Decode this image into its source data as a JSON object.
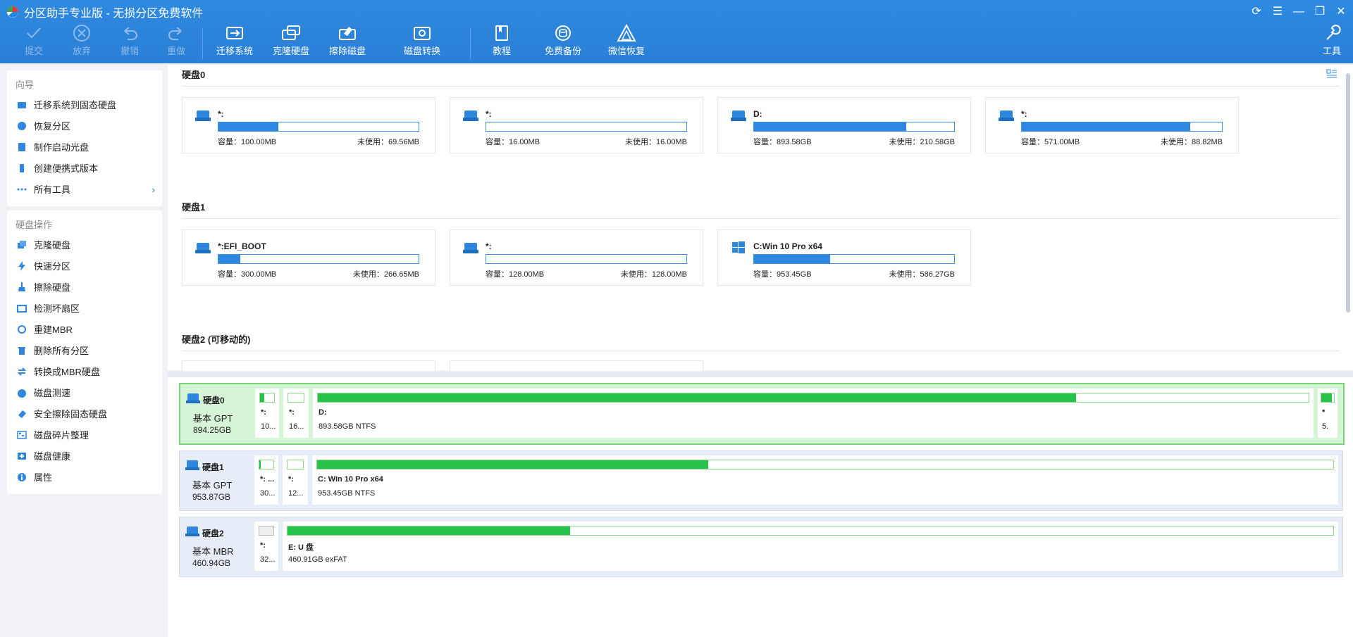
{
  "window": {
    "title": "分区助手专业版 - 无损分区免费软件"
  },
  "toolbar": {
    "commit": "提交",
    "discard": "放弃",
    "undo": "撤销",
    "redo": "重做",
    "migrate": "迁移系统",
    "clone": "克隆硬盘",
    "wipe": "擦除磁盘",
    "convert": "磁盘转换",
    "tutorial": "教程",
    "backup": "免费备份",
    "wechat": "微信恢复",
    "tools": "工具"
  },
  "sidebar": {
    "wizard_head": "向导",
    "wizard": [
      "迁移系统到固态硬盘",
      "恢复分区",
      "制作启动光盘",
      "创建便携式版本",
      "所有工具"
    ],
    "ops_head": "硬盘操作",
    "ops": [
      "克隆硬盘",
      "快速分区",
      "擦除硬盘",
      "检测坏扇区",
      "重建MBR",
      "删除所有分区",
      "转换成MBR硬盘",
      "磁盘测速",
      "安全擦除固态硬盘",
      "磁盘碎片整理",
      "磁盘健康",
      "属性"
    ]
  },
  "disks_view": {
    "disk0": {
      "label": "硬盘0",
      "parts": [
        {
          "name": "*:",
          "cap": "容量：100.00MB",
          "free": "未使用：69.56MB",
          "used": 0.3
        },
        {
          "name": "*:",
          "cap": "容量：16.00MB",
          "free": "未使用：16.00MB",
          "used": 0.0
        },
        {
          "name": "D:",
          "cap": "容量：893.58GB",
          "free": "未使用：210.58GB",
          "used": 0.76
        },
        {
          "name": "*:",
          "cap": "容量：571.00MB",
          "free": "未使用：88.82MB",
          "used": 0.84
        }
      ]
    },
    "disk1": {
      "label": "硬盘1",
      "parts": [
        {
          "name": "*:EFI_BOOT",
          "cap": "容量：300.00MB",
          "free": "未使用：266.65MB",
          "used": 0.11
        },
        {
          "name": "*:",
          "cap": "容量：128.00MB",
          "free": "未使用：128.00MB",
          "used": 0.0
        },
        {
          "name": "C:Win 10 Pro x64",
          "cap": "容量：953.45GB",
          "free": "未使用：586.27GB",
          "used": 0.38
        }
      ]
    },
    "disk2": {
      "label": "硬盘2 (可移动的)"
    }
  },
  "disk_map": [
    {
      "name": "硬盘0",
      "type": "基本 GPT",
      "size": "894.25GB",
      "segs": [
        {
          "label": "*:",
          "info": "10...",
          "used": 0.3
        },
        {
          "label": "*:",
          "info": "16...",
          "used": 0.0
        },
        {
          "label": "D:",
          "info": "893.58GB NTFS",
          "used": 0.765
        },
        {
          "label": "*",
          "info": "5.",
          "used": 0.84
        }
      ]
    },
    {
      "name": "硬盘1",
      "type": "基本 GPT",
      "size": "953.87GB",
      "segs": [
        {
          "label": "*: ...",
          "info": "30...",
          "used": 0.11
        },
        {
          "label": "*:",
          "info": "12...",
          "used": 0.0
        },
        {
          "label": "C: Win 10 Pro x64",
          "info": "953.45GB NTFS",
          "used": 0.385
        }
      ]
    },
    {
      "name": "硬盘2",
      "type": "基本 MBR",
      "size": "460.94GB",
      "segs": [
        {
          "label": "*:",
          "info": "32...",
          "used": 0.0
        },
        {
          "label": "E: U 盘",
          "info": "460.91GB exFAT",
          "used": 0.27
        }
      ]
    }
  ],
  "colors": {
    "accent": "#2e86de",
    "bar_blue": "#2f86e3",
    "bar_green": "#27c24c",
    "selected_row": "#d6f5d6"
  }
}
